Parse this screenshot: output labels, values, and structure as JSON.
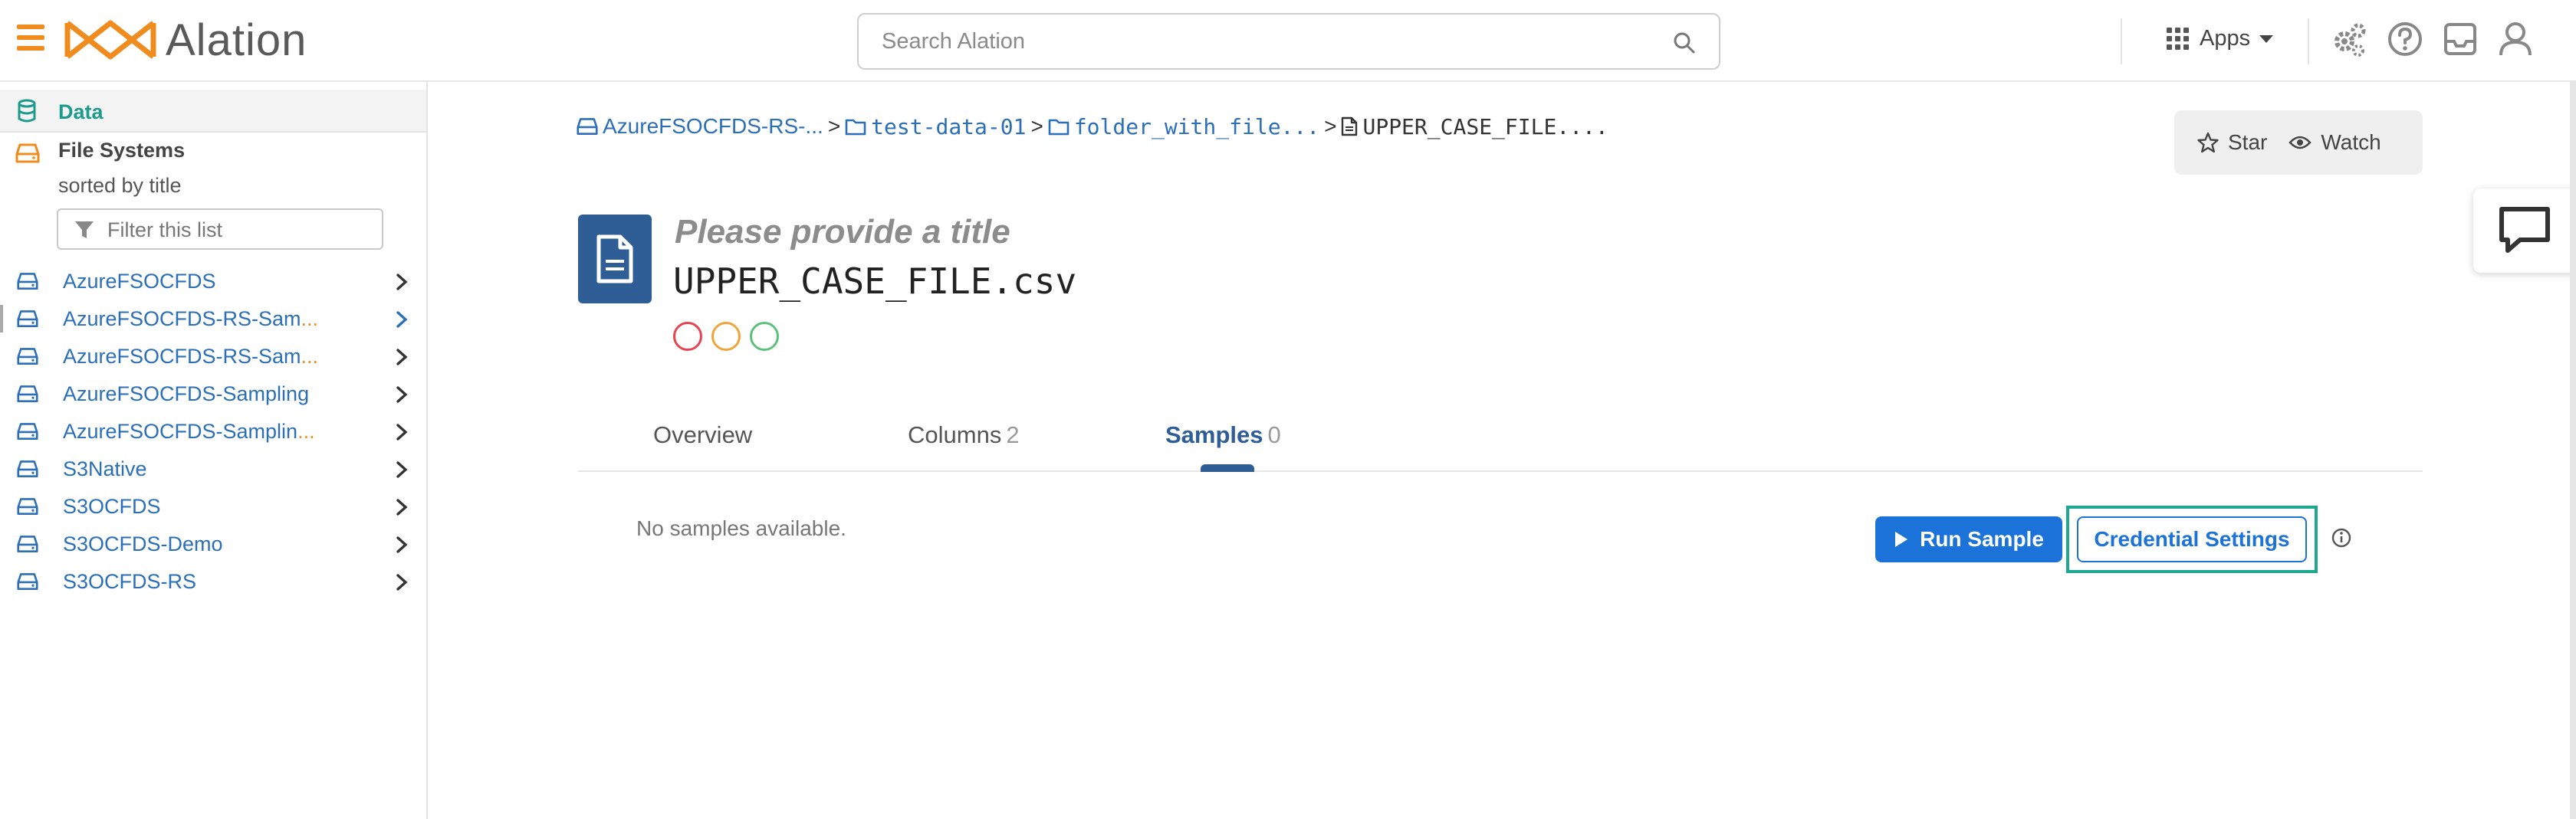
{
  "colors": {
    "brand_orange": "#f08c1e",
    "link_blue": "#2b6fb8",
    "teal": "#1a9b8c",
    "primary_button": "#1b72d9",
    "dark_blue": "#2f5e96",
    "highlight_border": "#1ea890",
    "status_red": "#e8434f",
    "status_amber": "#f0a43a",
    "status_green": "#5cc27a"
  },
  "header": {
    "logo_text": "Alation",
    "search": {
      "placeholder": "Search Alation"
    },
    "apps_label": "Apps",
    "icons": [
      "menu-icon",
      "search-icon",
      "apps-grid-icon",
      "settings-gears-icon",
      "help-icon",
      "inbox-icon",
      "user-icon"
    ]
  },
  "sidebar": {
    "data_label": "Data",
    "section_title": "File Systems",
    "sorted_by": "sorted by title",
    "filter_placeholder": "Filter this list",
    "items": [
      {
        "label": "AzureFSOCFDS",
        "ellipsis": ""
      },
      {
        "label": "AzureFSOCFDS-RS-Sam",
        "ellipsis": "..."
      },
      {
        "label": "AzureFSOCFDS-RS-Sam",
        "ellipsis": "..."
      },
      {
        "label": "AzureFSOCFDS-Sampling",
        "ellipsis": ""
      },
      {
        "label": "AzureFSOCFDS-Samplin",
        "ellipsis": "..."
      },
      {
        "label": "S3Native",
        "ellipsis": ""
      },
      {
        "label": "S3OCFDS",
        "ellipsis": ""
      },
      {
        "label": "S3OCFDS-Demo",
        "ellipsis": ""
      },
      {
        "label": "S3OCFDS-RS",
        "ellipsis": ""
      }
    ]
  },
  "breadcrumb": {
    "items": [
      "AzureFSOCFDS-RS-...",
      "test-data-01",
      "folder_with_file...",
      "UPPER_CASE_FILE...."
    ],
    "separator": ">"
  },
  "actions": {
    "star_label": "Star",
    "watch_label": "Watch"
  },
  "object": {
    "title_placeholder": "Please provide a title",
    "filename": "UPPER_CASE_FILE.csv"
  },
  "tabs": [
    {
      "label": "Overview",
      "count": ""
    },
    {
      "label": "Columns",
      "count": "2"
    },
    {
      "label": "Samples",
      "count": "0",
      "active": true
    }
  ],
  "samples": {
    "empty_text": "No samples available.",
    "run_button": "Run Sample",
    "credential_button": "Credential Settings"
  }
}
